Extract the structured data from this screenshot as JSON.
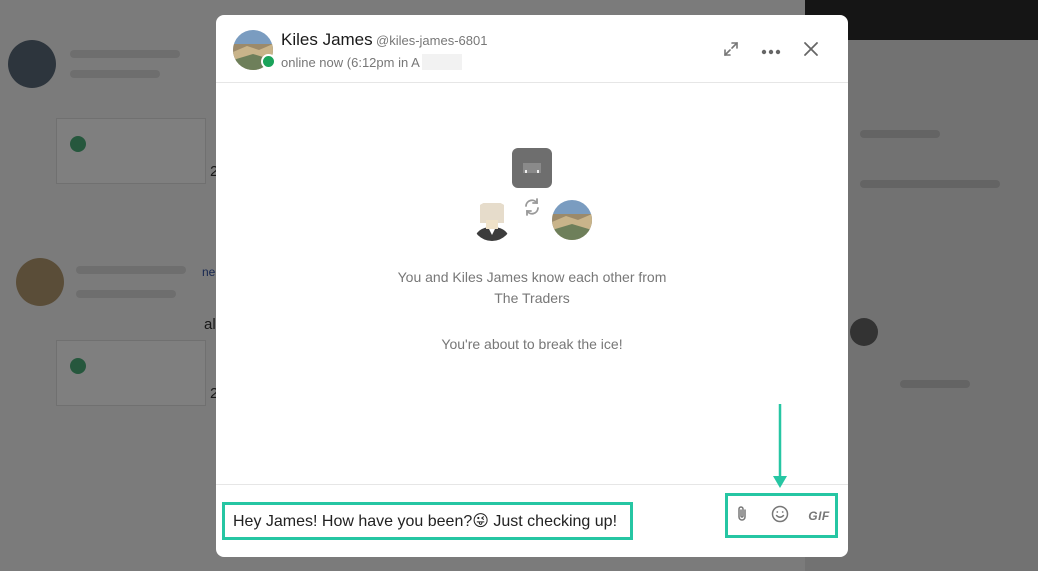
{
  "colors": {
    "accent": "#26c6a3",
    "online": "#1aa35a",
    "overlay": "rgba(0,0,0,0.5)"
  },
  "background": {
    "digit_a": "2",
    "digit_b": "2",
    "fragment_a": "ne",
    "fragment_b": "al"
  },
  "chat": {
    "user": {
      "name": "Kiles James",
      "handle": "@kiles-james-6801",
      "presence": "online now (6:12pm in A"
    },
    "header_icons": [
      "expand-icon",
      "more-options-icon",
      "close-icon"
    ],
    "connection": {
      "line1": "You and Kiles James know each other from",
      "line2": "The Traders",
      "line3": "You're about to break the ice!"
    },
    "composer": {
      "message_before_emoji": "Hey James! How have you been?",
      "emoji": "😜",
      "message_after_emoji": " Just checking up!",
      "tool_icons": [
        "attachment-icon",
        "emoji-icon",
        "gif-icon"
      ],
      "gif_label": "GIF"
    }
  }
}
